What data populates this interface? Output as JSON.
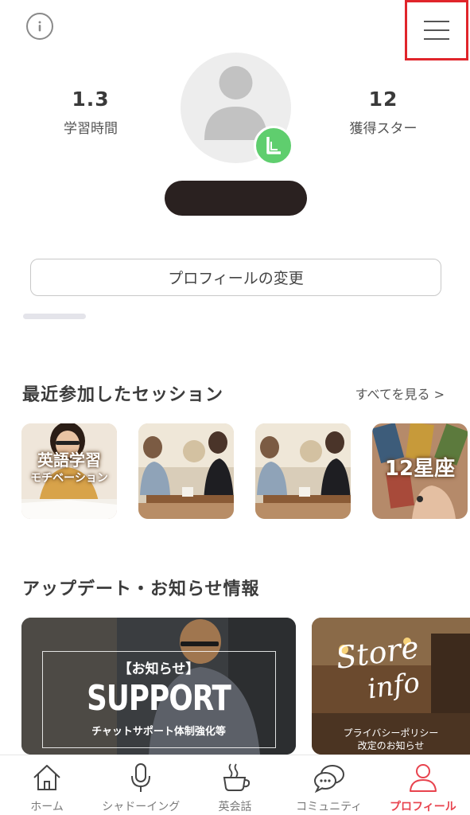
{
  "header": {
    "info_icon": "info-circle-icon",
    "menu_icon": "hamburger-menu-icon"
  },
  "stats": {
    "study_time_value": "1.3",
    "study_time_label": "学習時間",
    "stars_value": "12",
    "stars_label": "獲得スター"
  },
  "profile": {
    "edit_button_label": "プロフィールの変更"
  },
  "recent_sessions": {
    "title": "最近参加したセッション",
    "see_all_label": "すべてを見る >",
    "items": [
      {
        "line1": "英語学習",
        "line2": "モチベーション"
      },
      {
        "line1": "",
        "line2": ""
      },
      {
        "line1": "",
        "line2": ""
      },
      {
        "line1": "12星座",
        "line2": ""
      }
    ]
  },
  "news": {
    "title": "アップデート・お知らせ情報",
    "cards": [
      {
        "tag": "【お知らせ】",
        "headline": "SUPPORT",
        "caption": "チャットサポート体制強化等"
      },
      {
        "headline_line1": "Store",
        "headline_line2": "info",
        "caption_line1": "プライバシーポリシー",
        "caption_line2": "改定のお知らせ"
      }
    ]
  },
  "tabbar": {
    "tabs": [
      {
        "label": "ホーム",
        "icon": "home-icon",
        "active": false
      },
      {
        "label": "シャドーイング",
        "icon": "microphone-icon",
        "active": false
      },
      {
        "label": "英会話",
        "icon": "coffee-cup-icon",
        "active": false
      },
      {
        "label": "コミュニティ",
        "icon": "chat-bubbles-icon",
        "active": false
      },
      {
        "label": "プロフィール",
        "icon": "person-icon",
        "active": true
      }
    ]
  },
  "colors": {
    "accent": "#e8434e",
    "menu_highlight": "#e0252b",
    "level_badge": "#5fce6e",
    "name_pill": "#2a2120"
  }
}
